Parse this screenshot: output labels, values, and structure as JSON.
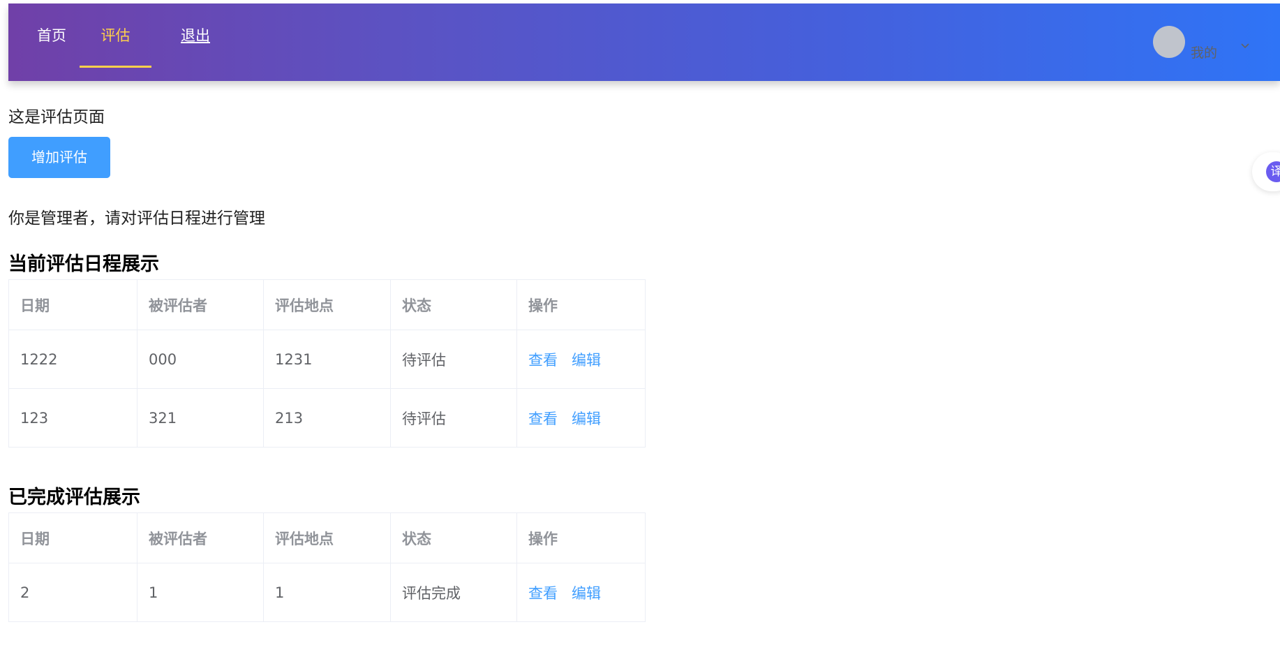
{
  "nav": {
    "items": [
      {
        "label": "首页"
      },
      {
        "label": "评估"
      },
      {
        "label": "退出"
      }
    ],
    "active": "评估",
    "user_label": "我的"
  },
  "page": {
    "intro": "这是评估页面",
    "add_button": "增加评估",
    "manager_notice": "你是管理者，请对评估日程进行管理"
  },
  "current": {
    "title": "当前评估日程展示",
    "headers": [
      "日期",
      "被评估者",
      "评估地点",
      "状态",
      "操作"
    ],
    "rows": [
      {
        "date": "1222",
        "assessee": "000",
        "location": "1231",
        "status": "待评估",
        "view": "查看",
        "edit": "编辑"
      },
      {
        "date": "123",
        "assessee": "321",
        "location": "213",
        "status": "待评估",
        "view": "查看",
        "edit": "编辑"
      }
    ]
  },
  "completed": {
    "title": "已完成评估展示",
    "headers": [
      "日期",
      "被评估者",
      "评估地点",
      "状态",
      "操作"
    ],
    "rows": [
      {
        "date": "2",
        "assessee": "1",
        "location": "1",
        "status": "评估完成",
        "view": "查看",
        "edit": "编辑"
      }
    ]
  },
  "widget": {
    "glyph": "译"
  },
  "colors": {
    "accent_active": "#ffd04b",
    "link": "#409eff",
    "button": "#409eff",
    "nav_gradient_start": "#7040a8",
    "nav_gradient_end": "#2f74f6"
  }
}
